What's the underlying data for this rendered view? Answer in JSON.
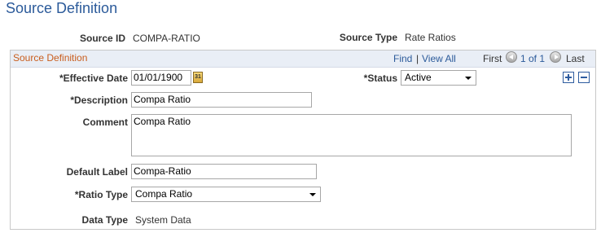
{
  "page": {
    "title": "Source Definition"
  },
  "header": {
    "source_id_label": "Source ID",
    "source_id_value": "COMPA-RATIO",
    "source_type_label": "Source Type",
    "source_type_value": "Rate Ratios"
  },
  "panel": {
    "title": "Source Definition",
    "find": "Find",
    "separator": "|",
    "view_all": "View All",
    "first": "First",
    "range": "1 of 1",
    "last": "Last",
    "icons": {
      "prev": "prev-circle-icon",
      "next": "next-circle-icon",
      "calendar": "calendar-icon",
      "add": "plus-icon",
      "delete": "minus-icon"
    }
  },
  "form": {
    "effective_date_label": "*Effective Date",
    "effective_date_value": "01/01/1900",
    "status_label": "*Status",
    "status_value": "Active",
    "description_label": "*Description",
    "description_value": "Compa Ratio",
    "comment_label": "Comment",
    "comment_value": "Compa Ratio",
    "default_label_label": "Default Label",
    "default_label_value": "Compa-Ratio",
    "ratio_type_label": "*Ratio Type",
    "ratio_type_value": "Compa Ratio",
    "data_type_label": "Data Type",
    "data_type_value": "System Data"
  },
  "colors": {
    "title": "#2b5a9a",
    "panel_title": "#c95d1d",
    "panel_header_bg": "#e9eef6",
    "link": "#2b5a9a"
  }
}
